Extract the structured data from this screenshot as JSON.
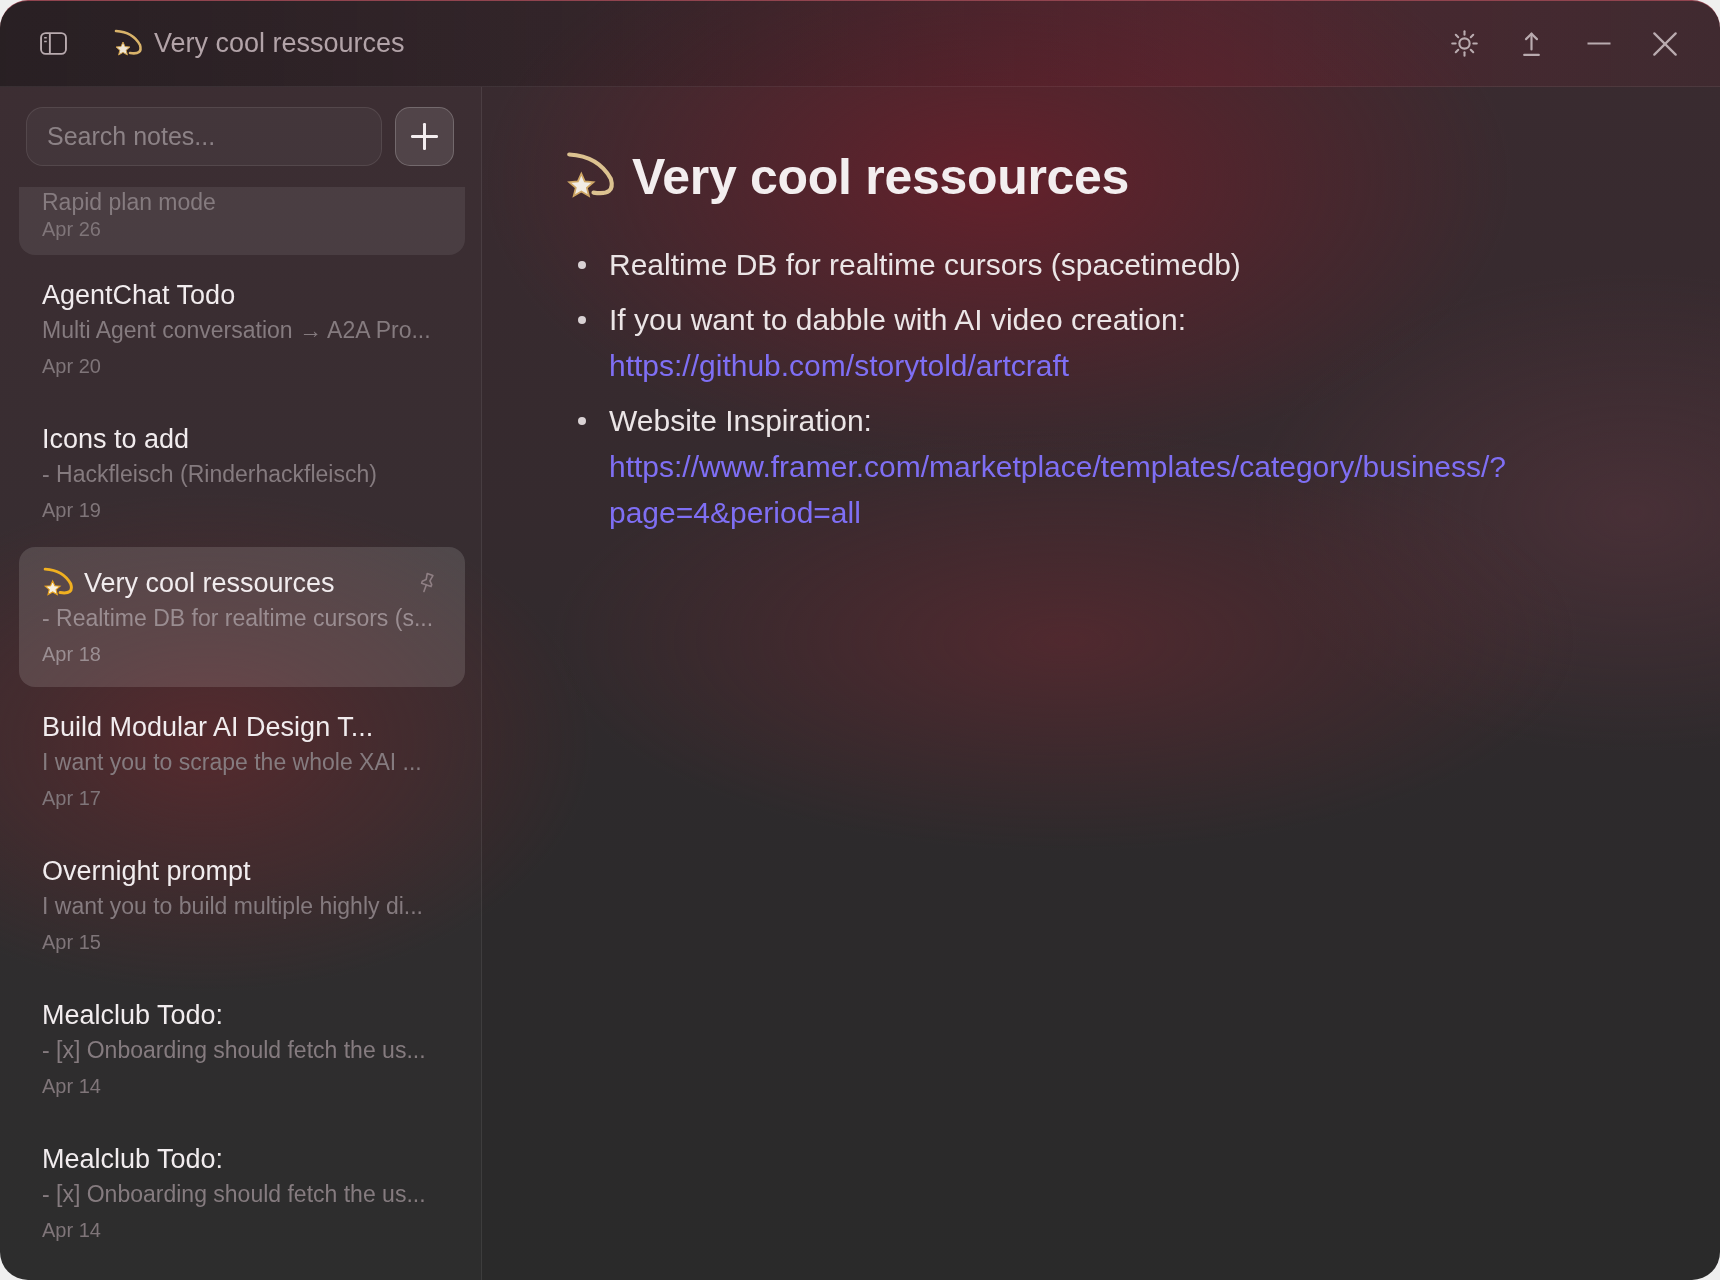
{
  "window": {
    "title": "Very cool ressources",
    "emoji": true
  },
  "sidebar": {
    "search": {
      "placeholder": "Search notes..."
    },
    "notes": [
      {
        "preview": "Rapid plan mode",
        "date": "Apr 26",
        "selected": false,
        "hovered": true
      },
      {
        "title": "AgentChat Todo",
        "preview": "Multi Agent conversation → A2A Pro...",
        "date": "Apr 20",
        "selected": false,
        "hovered": false,
        "emoji": false
      },
      {
        "title": "Icons to add",
        "preview": "- Hackfleisch (Rinderhackfleisch)",
        "date": "Apr 19",
        "selected": false,
        "hovered": false,
        "emoji": false
      },
      {
        "title": "Very cool ressources",
        "preview": "- Realtime DB for realtime cursors (s...",
        "date": "Apr 18",
        "selected": true,
        "hovered": false,
        "emoji": true
      },
      {
        "title": "Build Modular AI Design T...",
        "preview": "I want you to scrape the whole XAI ...",
        "date": "Apr 17",
        "selected": false,
        "hovered": false,
        "emoji": false
      },
      {
        "title": "Overnight prompt",
        "preview": "I want you to build multiple highly di...",
        "date": "Apr 15",
        "selected": false,
        "hovered": false,
        "emoji": false
      },
      {
        "title": "Mealclub Todo:",
        "preview": "- [x] Onboarding should fetch the us...",
        "date": "Apr 14",
        "selected": false,
        "hovered": false,
        "emoji": false
      },
      {
        "title": "Mealclub Todo:",
        "preview": "- [x] Onboarding should fetch the us...",
        "date": "Apr 14",
        "selected": false,
        "hovered": false,
        "emoji": false
      }
    ]
  },
  "document": {
    "title": "Very cool ressources",
    "emoji": true,
    "bullets": [
      {
        "text": "Realtime DB for realtime cursors (spacetimedb)"
      },
      {
        "text": "If you want to dabble with AI video creation:",
        "link": "https://github.com/storytold/artcraft"
      },
      {
        "text": "Website Inspiration:",
        "link": "https://www.framer.com/marketplace/templates/category/business/?page=4&period=all"
      }
    ]
  }
}
